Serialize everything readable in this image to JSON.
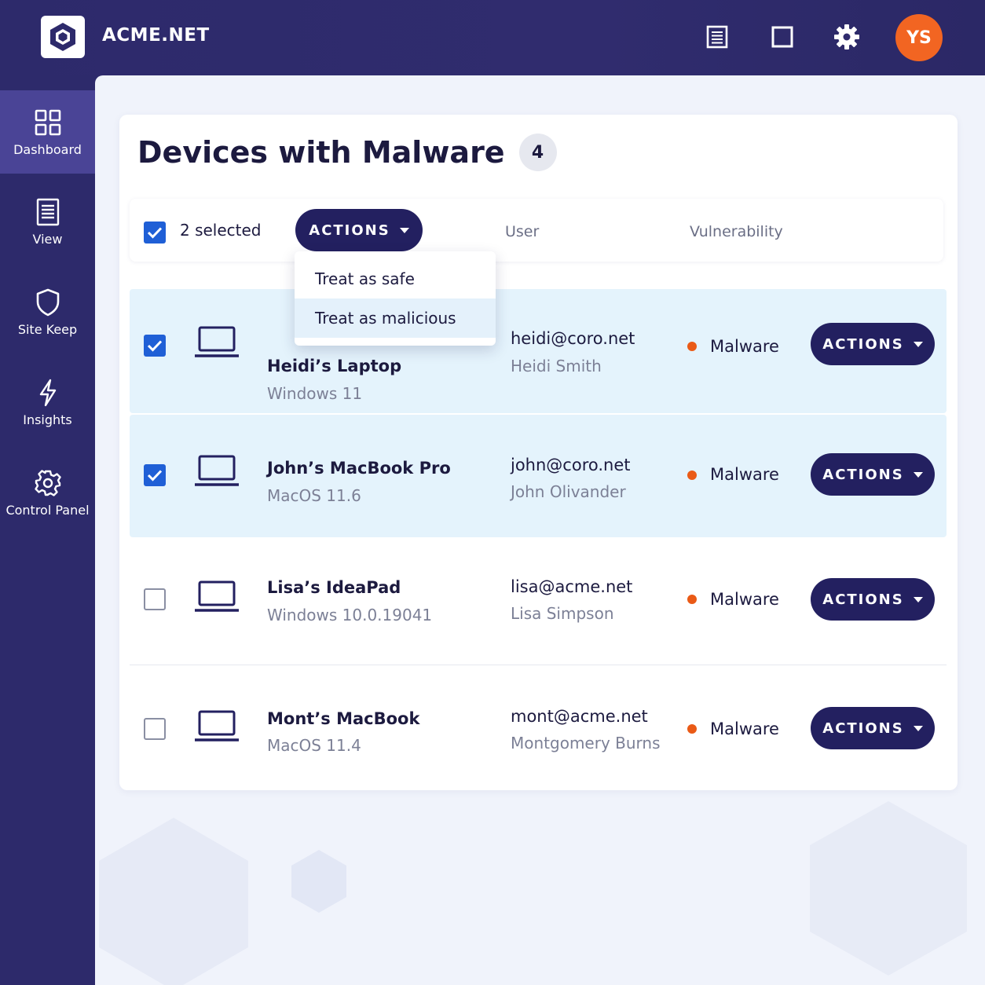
{
  "app": {
    "brand": "ACME.NET",
    "user_initials": "YS"
  },
  "topbar": {
    "icons": [
      "list-icon",
      "square-icon",
      "gear-icon"
    ]
  },
  "sidebar": {
    "items": [
      {
        "label": "Dashboard",
        "icon": "grid-icon",
        "active": true
      },
      {
        "label": "View",
        "icon": "document-icon",
        "active": false
      },
      {
        "label": "Site Keep",
        "icon": "shield-icon",
        "active": false
      },
      {
        "label": "Insights",
        "icon": "lightning-icon",
        "active": false
      },
      {
        "label": "Control Panel",
        "icon": "gear-icon",
        "active": false
      }
    ]
  },
  "main": {
    "title": "Devices with Malware",
    "count": "4",
    "toolbar": {
      "selected_text": "2 selected",
      "actions_label": "ACTIONS",
      "columns": {
        "user": "User",
        "vulnerability": "Vulnerability"
      }
    },
    "dropdown": {
      "items": [
        "Treat as safe",
        "Treat as malicious"
      ]
    },
    "rows": [
      {
        "checked": true,
        "device": "Heidi’s Laptop",
        "os": "Windows 11",
        "email": "heidi@coro.net",
        "user": "Heidi Smith",
        "vulnerability": "Malware",
        "actions_label": "ACTIONS"
      },
      {
        "checked": true,
        "device": "John’s MacBook Pro",
        "os": "MacOS 11.6",
        "email": "john@coro.net",
        "user": "John Olivander",
        "vulnerability": "Malware",
        "actions_label": "ACTIONS"
      },
      {
        "checked": false,
        "device": "Lisa’s IdeaPad",
        "os": "Windows 10.0.19041",
        "email": "lisa@acme.net",
        "user": "Lisa Simpson",
        "vulnerability": "Malware",
        "actions_label": "ACTIONS"
      },
      {
        "checked": false,
        "device": "Mont’s MacBook",
        "os": "MacOS 11.4",
        "email": "mont@acme.net",
        "user": "Montgomery Burns",
        "vulnerability": "Malware",
        "actions_label": "ACTIONS"
      }
    ]
  },
  "colors": {
    "nav_bg": "#2d2a6b",
    "nav_active": "#4a4496",
    "button_bg": "#232060",
    "checkbox_blue": "#1f5fd6",
    "avatar_orange": "#f26522",
    "status_orange": "#ea5a16",
    "row_selected_bg": "#e4f3fc"
  }
}
